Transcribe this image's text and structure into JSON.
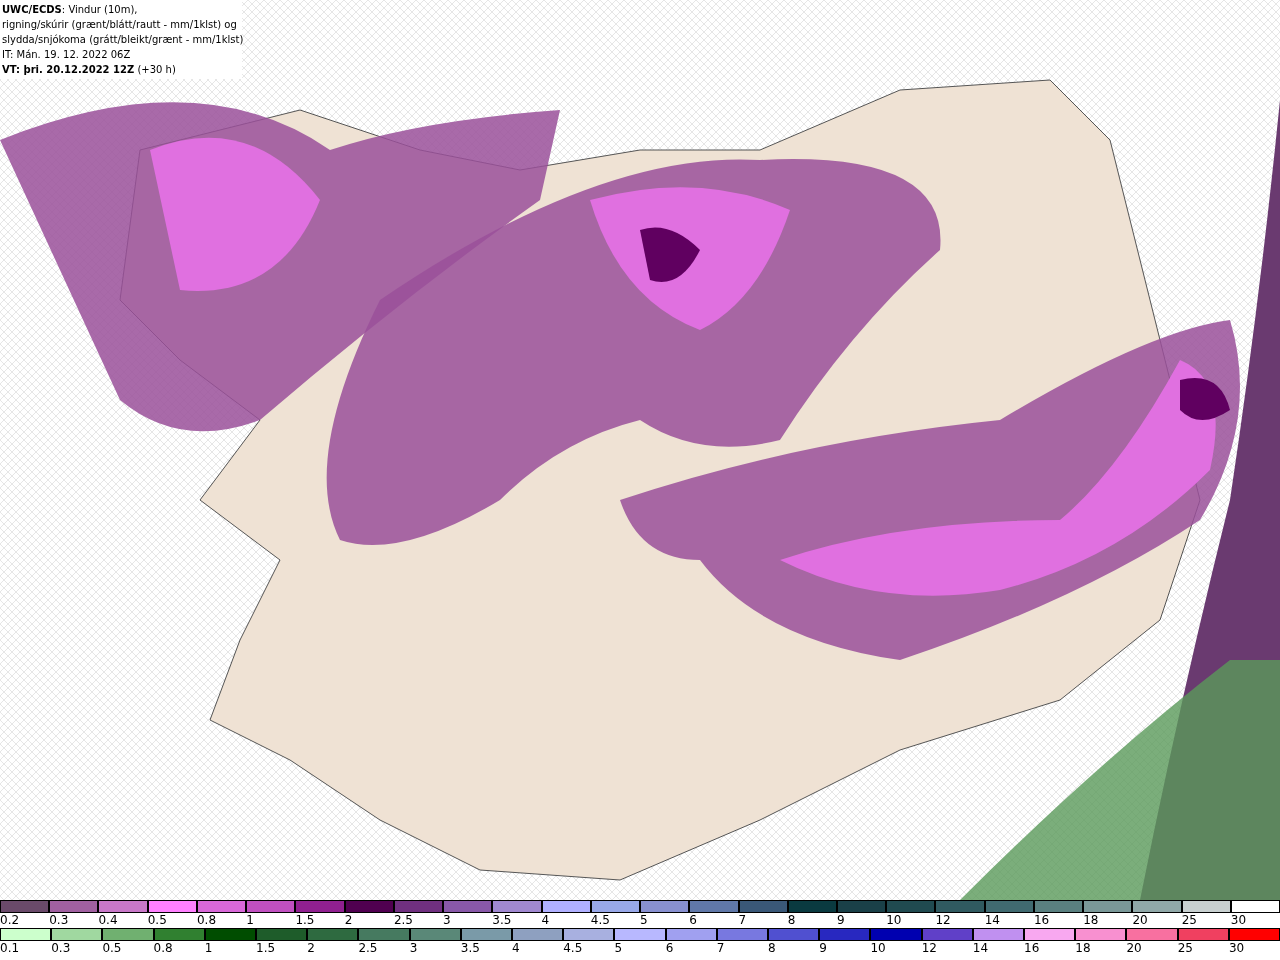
{
  "header": {
    "lines": [
      "**UWC/ECDS**: Vindur (10m),",
      "rigning/skúrir (grænt/blátt/rautt - mm/1klst) og",
      "slydda/snjókoma (grátt/bleikt/grænt - mm/1klst)",
      "IT: Mán. 19. 12. 2022 06Z",
      "**VT: þri. 20.12.2022 12Z** (+30 h)"
    ]
  },
  "legends": [
    {
      "items": [
        {
          "label": "0.2",
          "color": "#6a4a6a"
        },
        {
          "label": "0.3",
          "color": "#a060a0"
        },
        {
          "label": "0.4",
          "color": "#c878c8"
        },
        {
          "label": "0.5",
          "color": "#ff80ff"
        },
        {
          "label": "0.8",
          "color": "#d868d8"
        },
        {
          "label": "1",
          "color": "#c050c0"
        },
        {
          "label": "1.5",
          "color": "#902090"
        },
        {
          "label": "2",
          "color": "#500050"
        },
        {
          "label": "2.5",
          "color": "#703080"
        },
        {
          "label": "3",
          "color": "#8858a8"
        },
        {
          "label": "3.5",
          "color": "#a088d0"
        },
        {
          "label": "4",
          "color": "#b0b0ff"
        },
        {
          "label": "4.5",
          "color": "#98a8e8"
        },
        {
          "label": "5",
          "color": "#8890d0"
        },
        {
          "label": "6",
          "color": "#6078a8"
        },
        {
          "label": "7",
          "color": "#3a5878"
        },
        {
          "label": "8",
          "color": "#0a3a40"
        },
        {
          "label": "9",
          "color": "#1a4048"
        },
        {
          "label": "10",
          "color": "#204a50"
        },
        {
          "label": "12",
          "color": "#305a60"
        },
        {
          "label": "14",
          "color": "#406a70"
        },
        {
          "label": "16",
          "color": "#5a8080"
        },
        {
          "label": "18",
          "color": "#7a9898"
        },
        {
          "label": "20",
          "color": "#90a8a8"
        },
        {
          "label": "25",
          "color": "#c8d0d0"
        },
        {
          "label": "30",
          "color": "#ffffff"
        }
      ]
    },
    {
      "items": [
        {
          "label": "0.1",
          "color": "#ccffcc"
        },
        {
          "label": "0.3",
          "color": "#a0d8a0"
        },
        {
          "label": "0.5",
          "color": "#70b070"
        },
        {
          "label": "0.8",
          "color": "#308030"
        },
        {
          "label": "1",
          "color": "#004d00"
        },
        {
          "label": "1.5",
          "color": "#1e5c2a"
        },
        {
          "label": "2",
          "color": "#2e6a40"
        },
        {
          "label": "2.5",
          "color": "#467a60"
        },
        {
          "label": "3",
          "color": "#5a8878"
        },
        {
          "label": "3.5",
          "color": "#7a9aa8"
        },
        {
          "label": "4",
          "color": "#8ea0c0"
        },
        {
          "label": "4.5",
          "color": "#a8b0e0"
        },
        {
          "label": "5",
          "color": "#b8b8ff"
        },
        {
          "label": "6",
          "color": "#a0a0f0"
        },
        {
          "label": "7",
          "color": "#7878e0"
        },
        {
          "label": "8",
          "color": "#5050d0"
        },
        {
          "label": "9",
          "color": "#2828c0"
        },
        {
          "label": "10",
          "color": "#0000b0"
        },
        {
          "label": "12",
          "color": "#6040c8"
        },
        {
          "label": "14",
          "color": "#c090f0"
        },
        {
          "label": "16",
          "color": "#f8a8f0"
        },
        {
          "label": "18",
          "color": "#f890d0"
        },
        {
          "label": "20",
          "color": "#f870a0"
        },
        {
          "label": "25",
          "color": "#f04060"
        },
        {
          "label": "30",
          "color": "#ff0000"
        }
      ]
    }
  ]
}
